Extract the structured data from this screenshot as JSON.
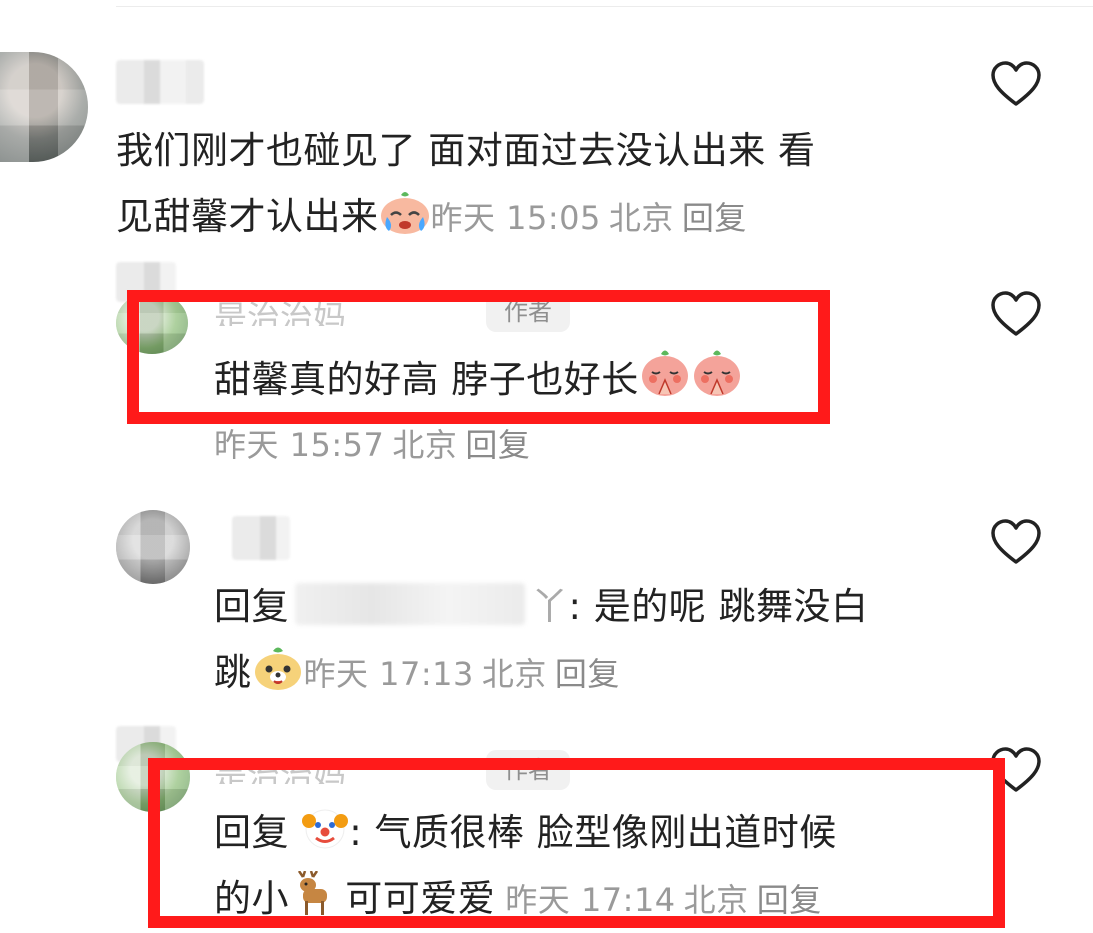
{
  "comments": [
    {
      "text_line1": "我们刚才也碰见了 面对面过去没认出来 看",
      "text_line2": "见甜馨才认出来",
      "time": "昨天 15:05",
      "location": "北京",
      "reply_label": "回复"
    },
    {
      "author_tag": "作者",
      "author_name_partial": "是治治妈",
      "text": "甜馨真的好高 脖子也好长",
      "time": "昨天 15:57",
      "location": "北京",
      "reply_label": "回复"
    },
    {
      "reply_prefix": "回复",
      "name_suffix": "丫",
      "text_line1": ": 是的呢 跳舞没白",
      "text_line2": "跳",
      "time": "昨天 17:13",
      "location": "北京",
      "reply_label": "回复"
    },
    {
      "author_tag": "作者",
      "author_name_partial": "是治治妈",
      "reply_prefix": "回复",
      "text_line1": ": 气质很棒 脸型像刚出道时候",
      "text_line2a": "的小",
      "text_line2b": " 可可爱爱",
      "time": "昨天 17:14",
      "location": "北京",
      "reply_label": "回复"
    }
  ],
  "colors": {
    "highlight": "#ff1a1a",
    "meta_text": "#9a9a9a",
    "body_text": "#222222"
  },
  "icons": [
    "heart-outline-icon",
    "crying-emoji-icon",
    "pray-emoji-icon",
    "dog-emoji-icon",
    "clown-emoji-icon",
    "deer-emoji-icon"
  ]
}
